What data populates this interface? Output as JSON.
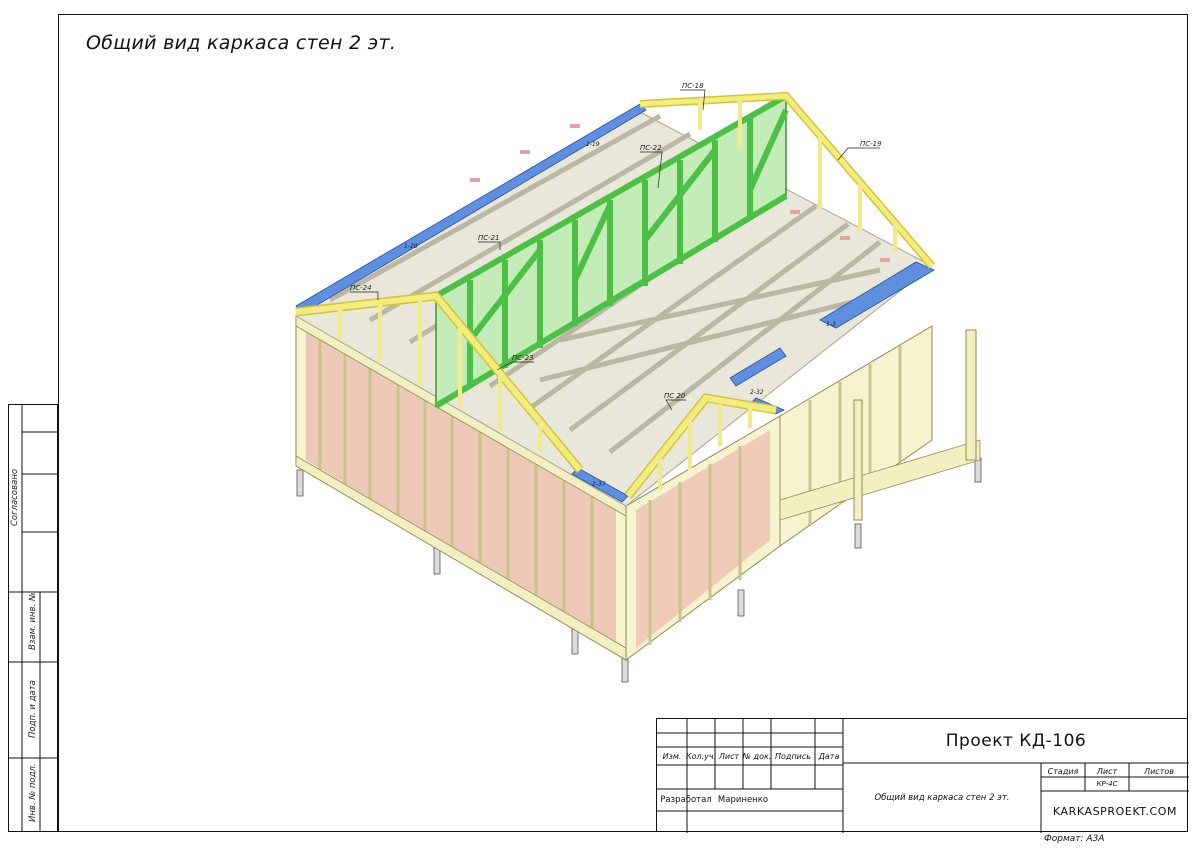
{
  "sheet_title": "Общий вид каркаса стен 2 эт.",
  "side_stamp": {
    "agreed": "Согласовано",
    "inv_replace": "Взам. инв. №",
    "sign_date": "Подп. и дата",
    "inv_orig": "Инв. № подл."
  },
  "title_block": {
    "project": "Проект КД-106",
    "headers": [
      "Изм.",
      "Кол.уч.",
      "Лист",
      "№ док.",
      "Подпись",
      "Дата"
    ],
    "developed_label": "Разработал",
    "developer": "Мариненко",
    "sheet_name": "Общий вид каркаса стен 2 эт.",
    "stage_label": "Стадия",
    "sheet_label": "Лист",
    "sheets_label": "Листов",
    "sheet_number": "КР-4С",
    "website": "KARKASPROEKT.COM",
    "format": "Формат: А3А"
  },
  "drawing_labels": {
    "ps18": "ПС-18",
    "ps19": "ПС-19",
    "ps20": "ПС 20",
    "ps21": "ПС-21",
    "ps22": "ПС-22",
    "ps23": "ПС-23",
    "ps24": "ПС-24",
    "beam_left": "1-20",
    "beam_mid": "1-19",
    "beam_right": "1-3",
    "beam_step": "2-32",
    "beam_front": "2-37"
  },
  "colors": {
    "yellow_truss": "#f1ea7a",
    "green_wall": "#6fd66a",
    "blue_beam": "#5f8fe0",
    "frame_wood": "#f2f0c8",
    "floor_pink": "#e8b7ab",
    "gray_joists": "#d6d6c8"
  }
}
